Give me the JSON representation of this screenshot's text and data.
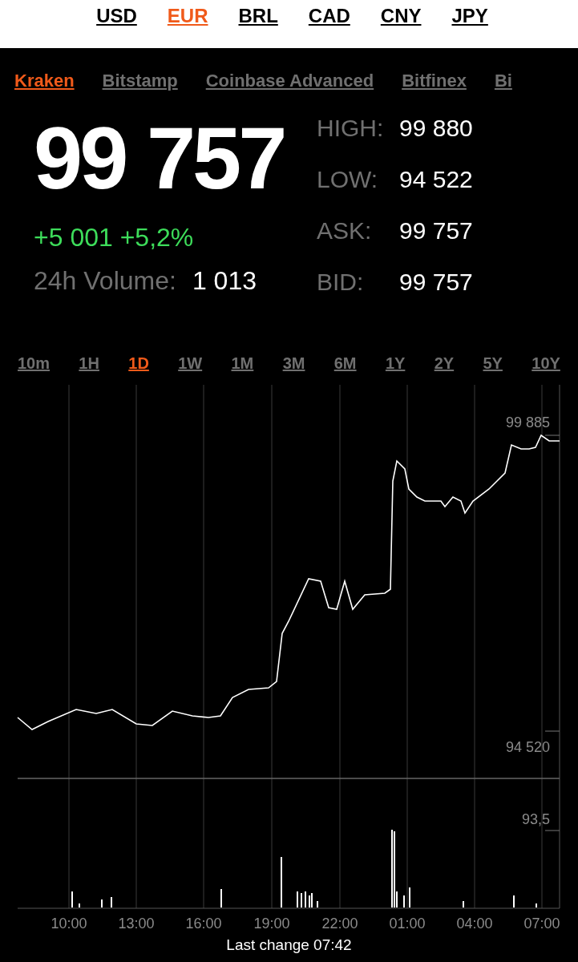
{
  "currencies": [
    {
      "label": "USD",
      "selected": false
    },
    {
      "label": "EUR",
      "selected": true
    },
    {
      "label": "BRL",
      "selected": false
    },
    {
      "label": "CAD",
      "selected": false
    },
    {
      "label": "CNY",
      "selected": false
    },
    {
      "label": "JPY",
      "selected": false
    }
  ],
  "exchanges": [
    {
      "label": "Kraken",
      "selected": true
    },
    {
      "label": "Bitstamp",
      "selected": false
    },
    {
      "label": "Coinbase Advanced",
      "selected": false
    },
    {
      "label": "Bitfinex",
      "selected": false
    },
    {
      "label": "Bi",
      "selected": false
    }
  ],
  "price": {
    "last": "99 757",
    "change": "+5 001 +5,2%",
    "volume_label": "24h Volume:",
    "volume": "1 013"
  },
  "stats": [
    {
      "label": "HIGH:",
      "value": "99 880"
    },
    {
      "label": "LOW:",
      "value": "94 522"
    },
    {
      "label": "ASK:",
      "value": "99 757"
    },
    {
      "label": "BID:",
      "value": "99 757"
    }
  ],
  "ranges": [
    {
      "label": "10m",
      "selected": false
    },
    {
      "label": "1H",
      "selected": false
    },
    {
      "label": "1D",
      "selected": true
    },
    {
      "label": "1W",
      "selected": false
    },
    {
      "label": "1M",
      "selected": false
    },
    {
      "label": "3M",
      "selected": false
    },
    {
      "label": "6M",
      "selected": false
    },
    {
      "label": "1Y",
      "selected": false
    },
    {
      "label": "2Y",
      "selected": false
    },
    {
      "label": "5Y",
      "selected": false
    },
    {
      "label": "10Y",
      "selected": false
    }
  ],
  "chart": {
    "price_max": "99 885",
    "price_min": "94 520",
    "volume_max": "93,5",
    "times": [
      "10:00",
      "13:00",
      "16:00",
      "19:00",
      "22:00",
      "01:00",
      "04:00",
      "07:00"
    ]
  },
  "status": "Last change 07:42"
}
